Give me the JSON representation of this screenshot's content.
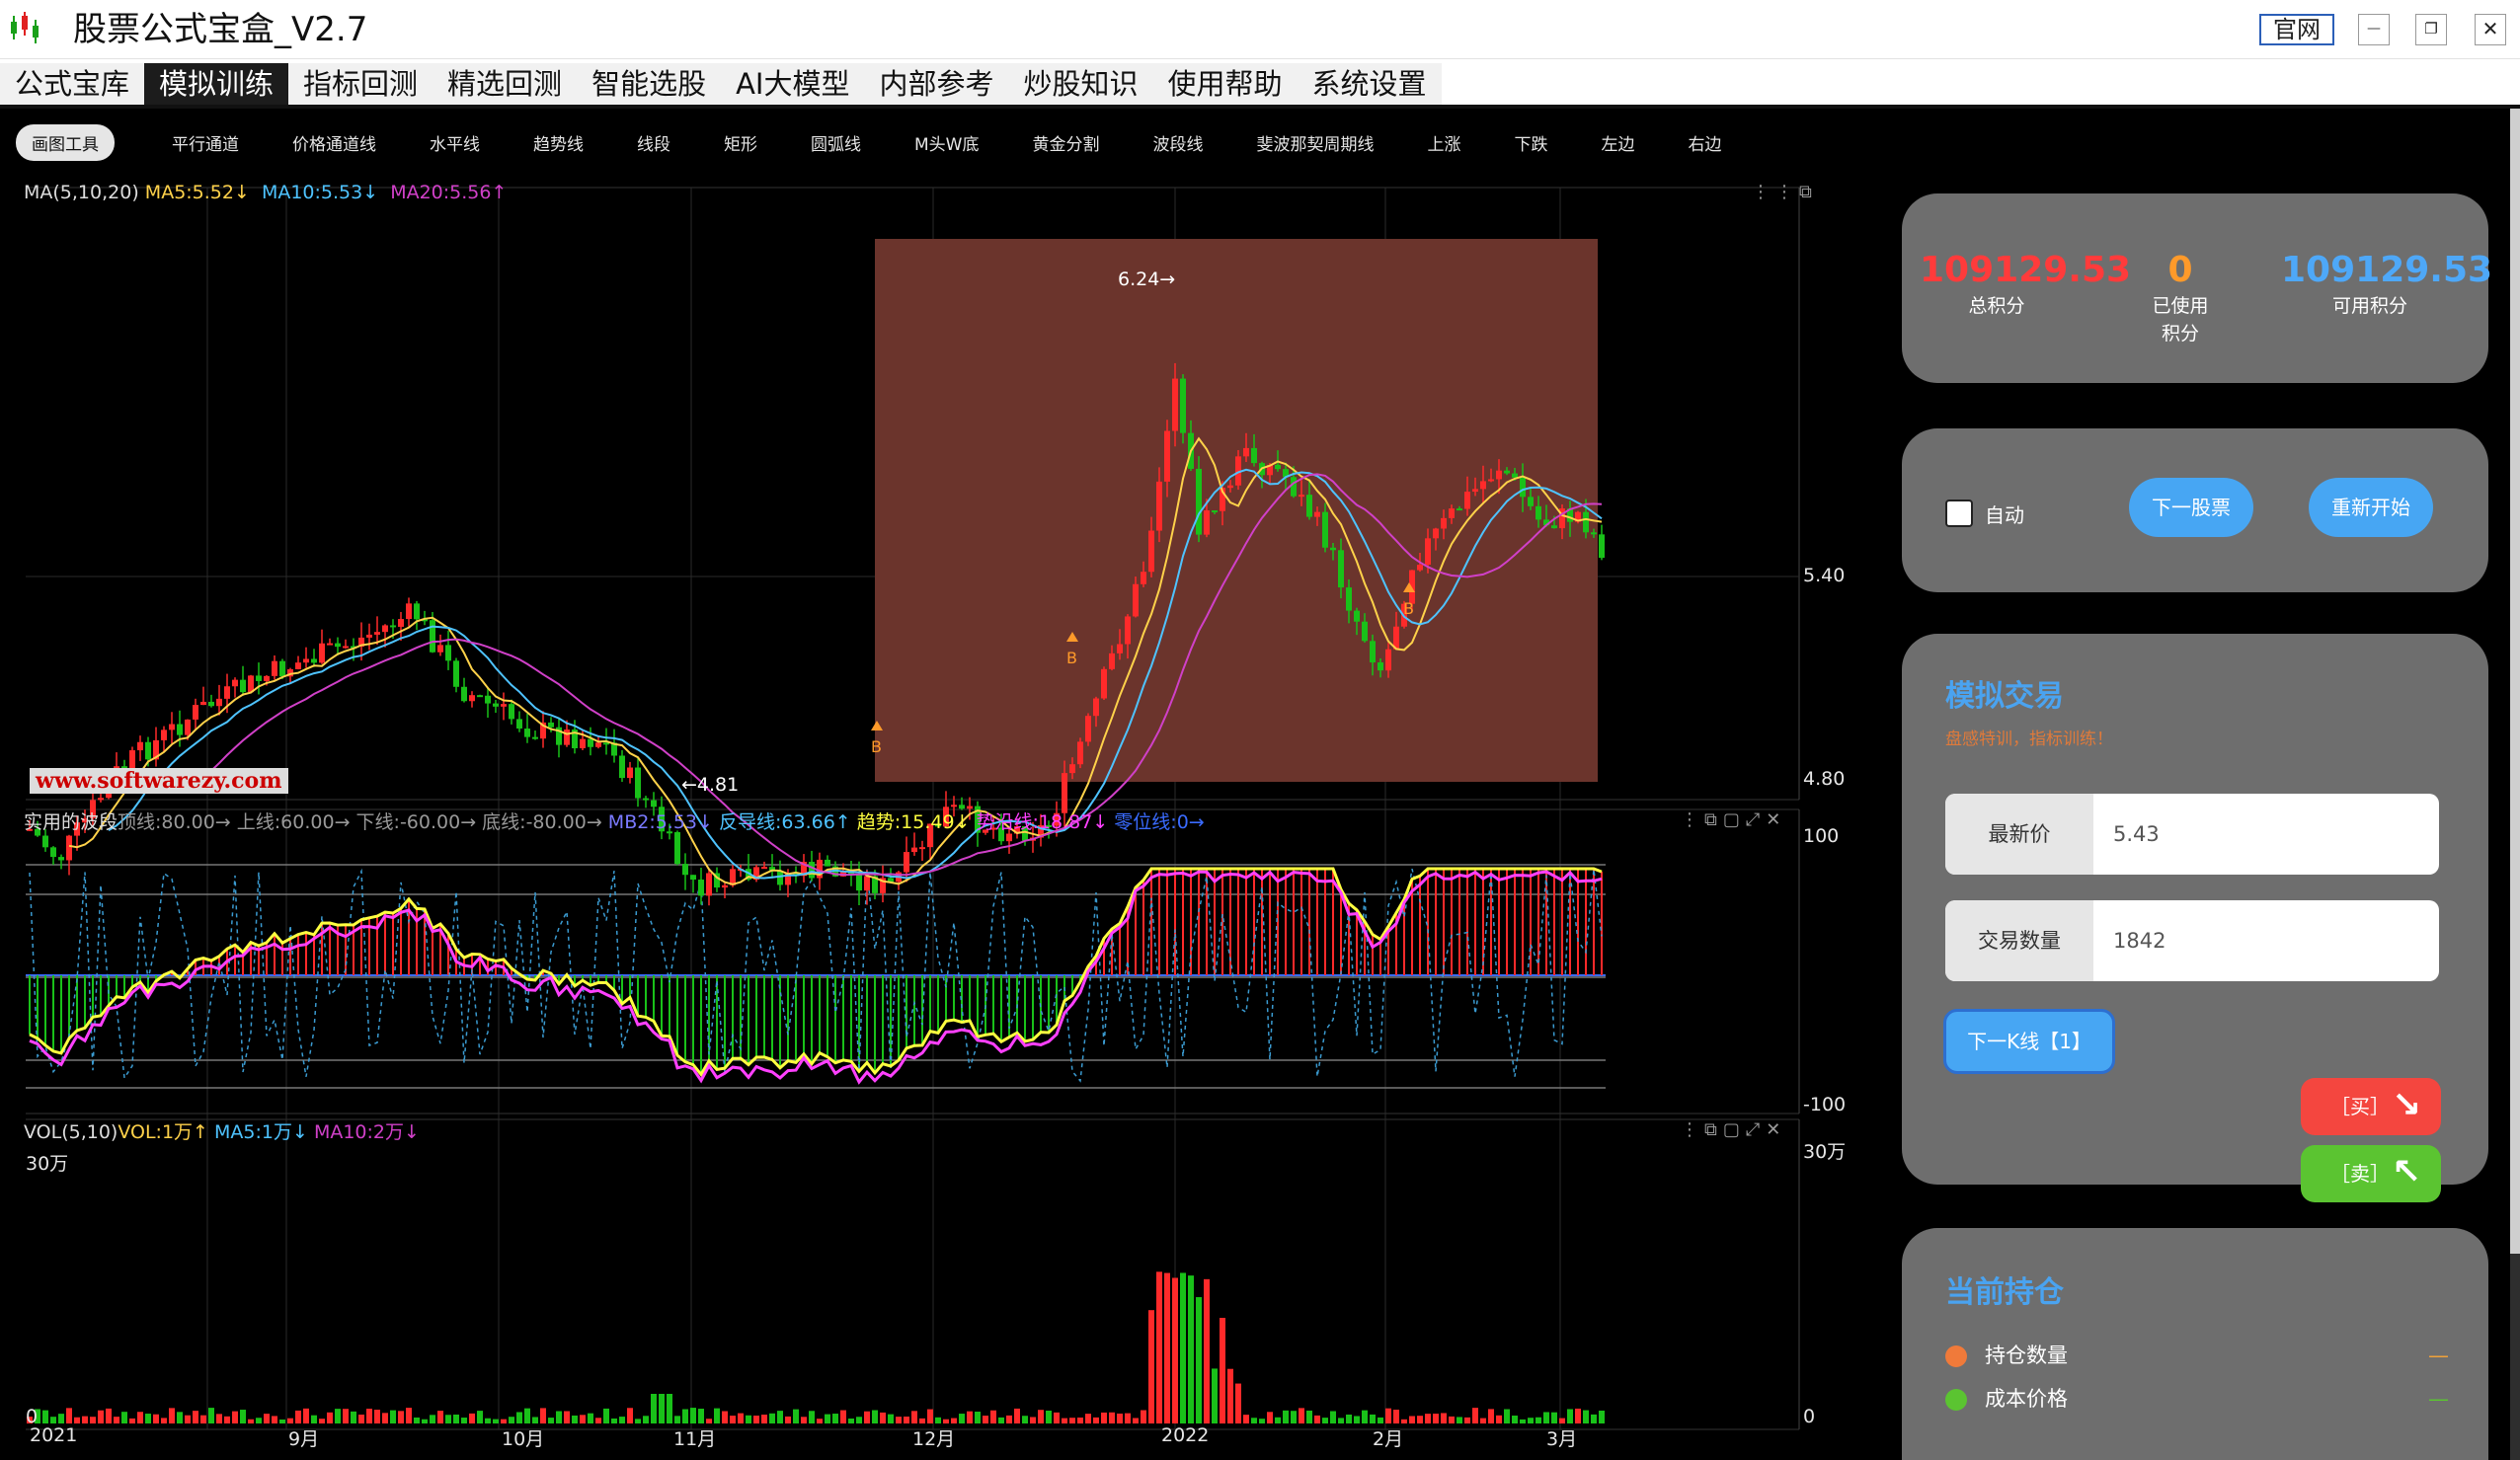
{
  "window": {
    "title": "股票公式宝盒_V2.7",
    "official_site": "官网",
    "minimize": "—",
    "restore": "❐",
    "close": "✕"
  },
  "menu": [
    "公式宝库",
    "模拟训练",
    "指标回测",
    "精选回测",
    "智能选股",
    "AI大模型",
    "内部参考",
    "炒股知识",
    "使用帮助",
    "系统设置"
  ],
  "active_menu": "模拟训练",
  "toolbar": [
    "画图工具",
    "平行通道",
    "价格通道线",
    "水平线",
    "趋势线",
    "线段",
    "矩形",
    "圆弧线",
    "M头W底",
    "黄金分割",
    "波段线",
    "斐波那契周期线",
    "上涨",
    "下跌",
    "左边",
    "右边"
  ],
  "colors": {
    "up": "#ff2a2a",
    "down": "#19c119",
    "ma5": "#ffd24a",
    "ma10": "#4ec3ff",
    "ma20": "#d040c8",
    "highlight": "#6b342c",
    "accent_blue": "#47a6f3",
    "card_bg": "#6e6e6e"
  },
  "price_pane": {
    "legend_name": "MA(5,10,20)",
    "ma5": "MA5:5.52↓",
    "ma10": "MA10:5.53↓",
    "ma20": "MA20:5.56↑",
    "axis_high": "5.40",
    "axis_low": "4.80",
    "max_label": "6.24→",
    "min_label": "←4.81",
    "buy_marker": "B",
    "watermark": "www.softwarezy.com"
  },
  "wave_pane": {
    "name": "实用的波段",
    "top": "顶线:80.00→",
    "upper": "上线:60.00→",
    "lower": "下线:-60.00→",
    "bottom": "底线:-80.00→",
    "mb2": "MB2:5.53↓",
    "fdx": "反导线:63.66↑",
    "trend": "趋势:15.49↓",
    "syx": "势沿线:18.87↓",
    "zero": "零位线:0→",
    "axis_top": "100",
    "axis_bottom": "-100"
  },
  "vol_pane": {
    "name": "VOL(5,10)",
    "vol": "VOL:1万↑",
    "ma5": "MA5:1万↓",
    "ma10": "MA10:2万↓",
    "axis_top_left": "30万",
    "axis_top_right": "30万",
    "axis_zero_left": "0",
    "axis_zero_right": "0"
  },
  "dates": [
    "2021",
    "9月",
    "10月",
    "11月",
    "12月",
    "2022",
    "2月",
    "3月"
  ],
  "points": {
    "total": "109129.53",
    "total_label": "总积分",
    "used": "0",
    "used_label_1": "已使用",
    "used_label_2": "积分",
    "available": "109129.53",
    "available_label": "可用积分"
  },
  "controls": {
    "auto_label": "自动",
    "next_stock": "下一股票",
    "restart": "重新开始"
  },
  "trade": {
    "title": "模拟交易",
    "subtitle": "盘感特训，指标训练！",
    "price_label": "最新价",
    "price_value": "5.43",
    "qty_label": "交易数量",
    "qty_value": "1842",
    "next_k": "下一K线【1】",
    "buy": "［买］",
    "sell": "［卖］"
  },
  "position": {
    "title": "当前持仓",
    "rows": [
      {
        "label": "持仓数量",
        "value": "—",
        "color": "#f07a3a"
      },
      {
        "label": "成本价格",
        "value": "—",
        "color": "#5bc431"
      }
    ]
  }
}
